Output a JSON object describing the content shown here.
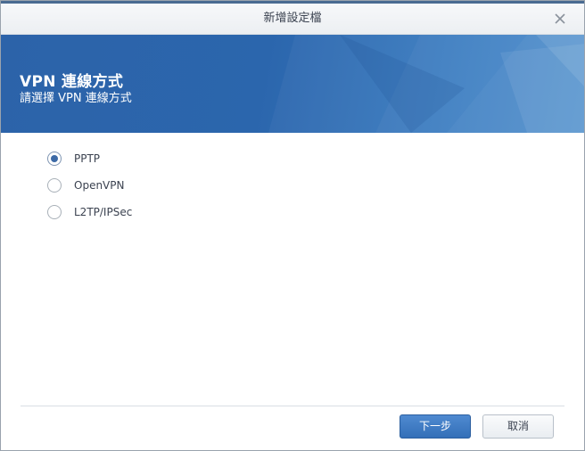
{
  "dialog": {
    "title": "新增設定檔"
  },
  "header": {
    "title": "VPN 連線方式",
    "subtitle": "請選擇 VPN 連線方式"
  },
  "options": [
    {
      "label": "PPTP",
      "checked": true
    },
    {
      "label": "OpenVPN",
      "checked": false
    },
    {
      "label": "L2TP/IPSec",
      "checked": false
    }
  ],
  "footer": {
    "next_label": "下一步",
    "cancel_label": "取消"
  },
  "colors": {
    "header_blue": "#2c63a9",
    "primary_button": "#336fb8",
    "radio_selected": "#3d6aa6"
  },
  "icons": {
    "close": "close-icon"
  }
}
